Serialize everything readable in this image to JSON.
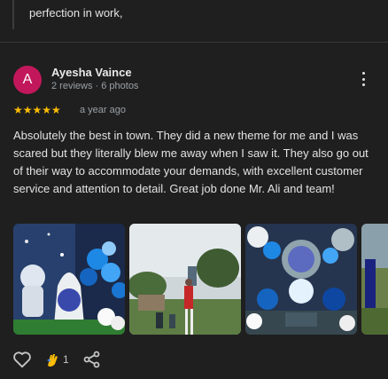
{
  "previous_review": {
    "text_tail": "perfection in work,"
  },
  "review": {
    "author": {
      "name": "Ayesha Vaince",
      "initial": "A",
      "stats": "2 reviews · 6 photos",
      "avatar_color": "#c2185b"
    },
    "rating": {
      "stars": 5,
      "max": 5,
      "glyphs": "★★★★★"
    },
    "date": "a year ago",
    "text": "Absolutely the best in town. They did a new theme for me and I was scared but they literally blew me away when I saw it. They also go out of their way to accommodate your demands, with excellent customer service and attention to detail. Great job done Mr. Ali and team!",
    "photos": [
      {
        "icon": "photo-astronaut-rocket-decor"
      },
      {
        "icon": "photo-stilt-walker-outdoor"
      },
      {
        "icon": "photo-space-theme-stage"
      },
      {
        "icon": "photo-partial-fourth"
      }
    ]
  },
  "actions": {
    "like_icon": "heart-icon",
    "reaction_icon": "clap-icon",
    "reaction_count": "1",
    "share_icon": "share-icon"
  },
  "colors": {
    "accent_star": "#fbbc04",
    "background": "#1f1f1f"
  }
}
